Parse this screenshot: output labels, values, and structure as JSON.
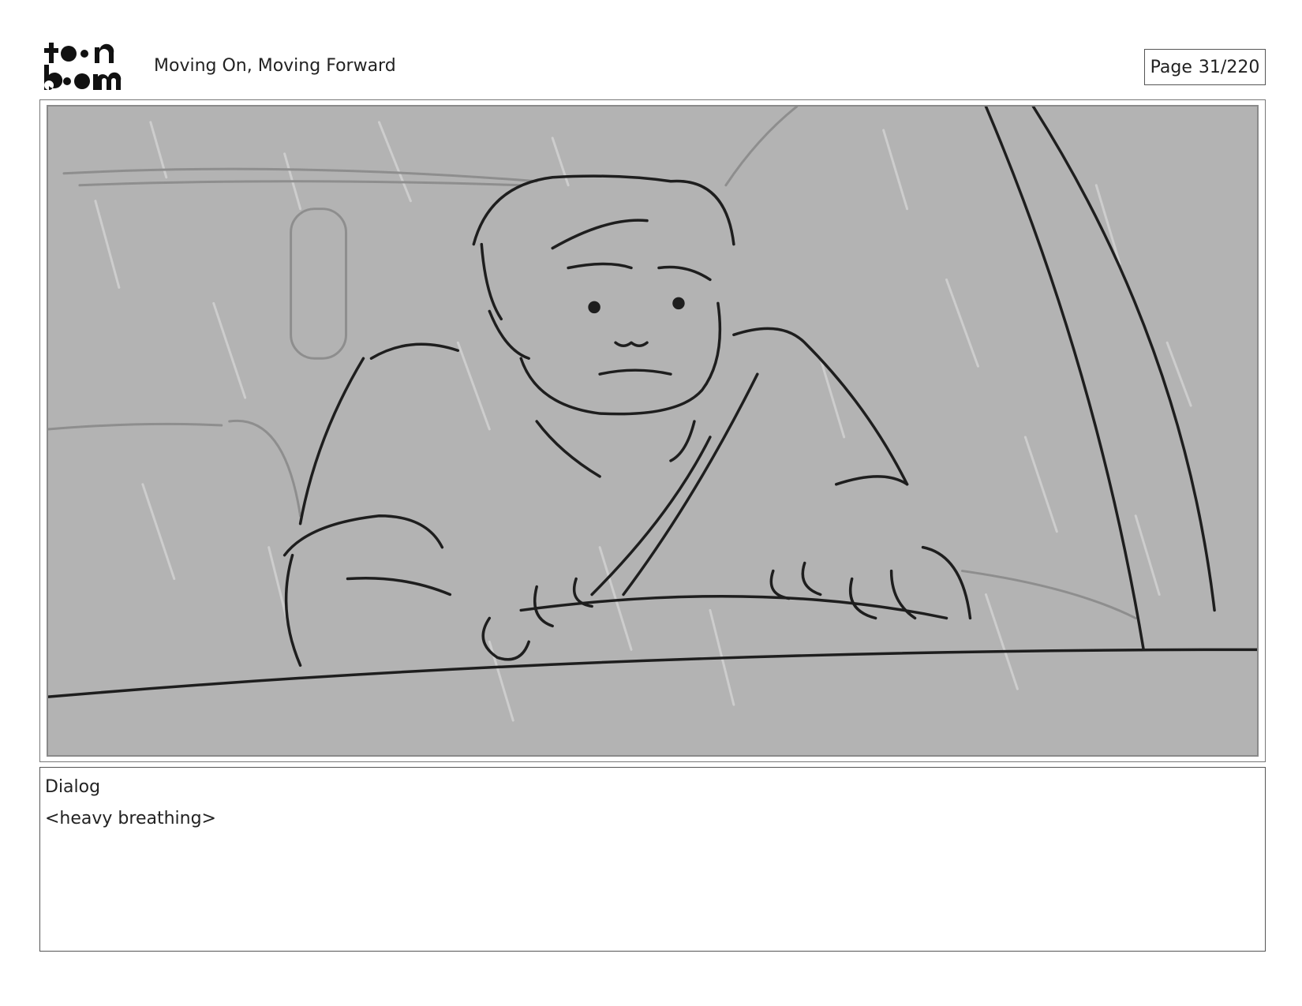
{
  "header": {
    "logo_text": "toon boom",
    "project_title": "Moving On, Moving Forward",
    "page_label": "Page",
    "page_number": "31/220"
  },
  "panel": {
    "image_icon": "storyboard-sketch",
    "background_color": "#b3b3b3"
  },
  "dialog": {
    "label": "Dialog",
    "text": "<heavy breathing>"
  }
}
